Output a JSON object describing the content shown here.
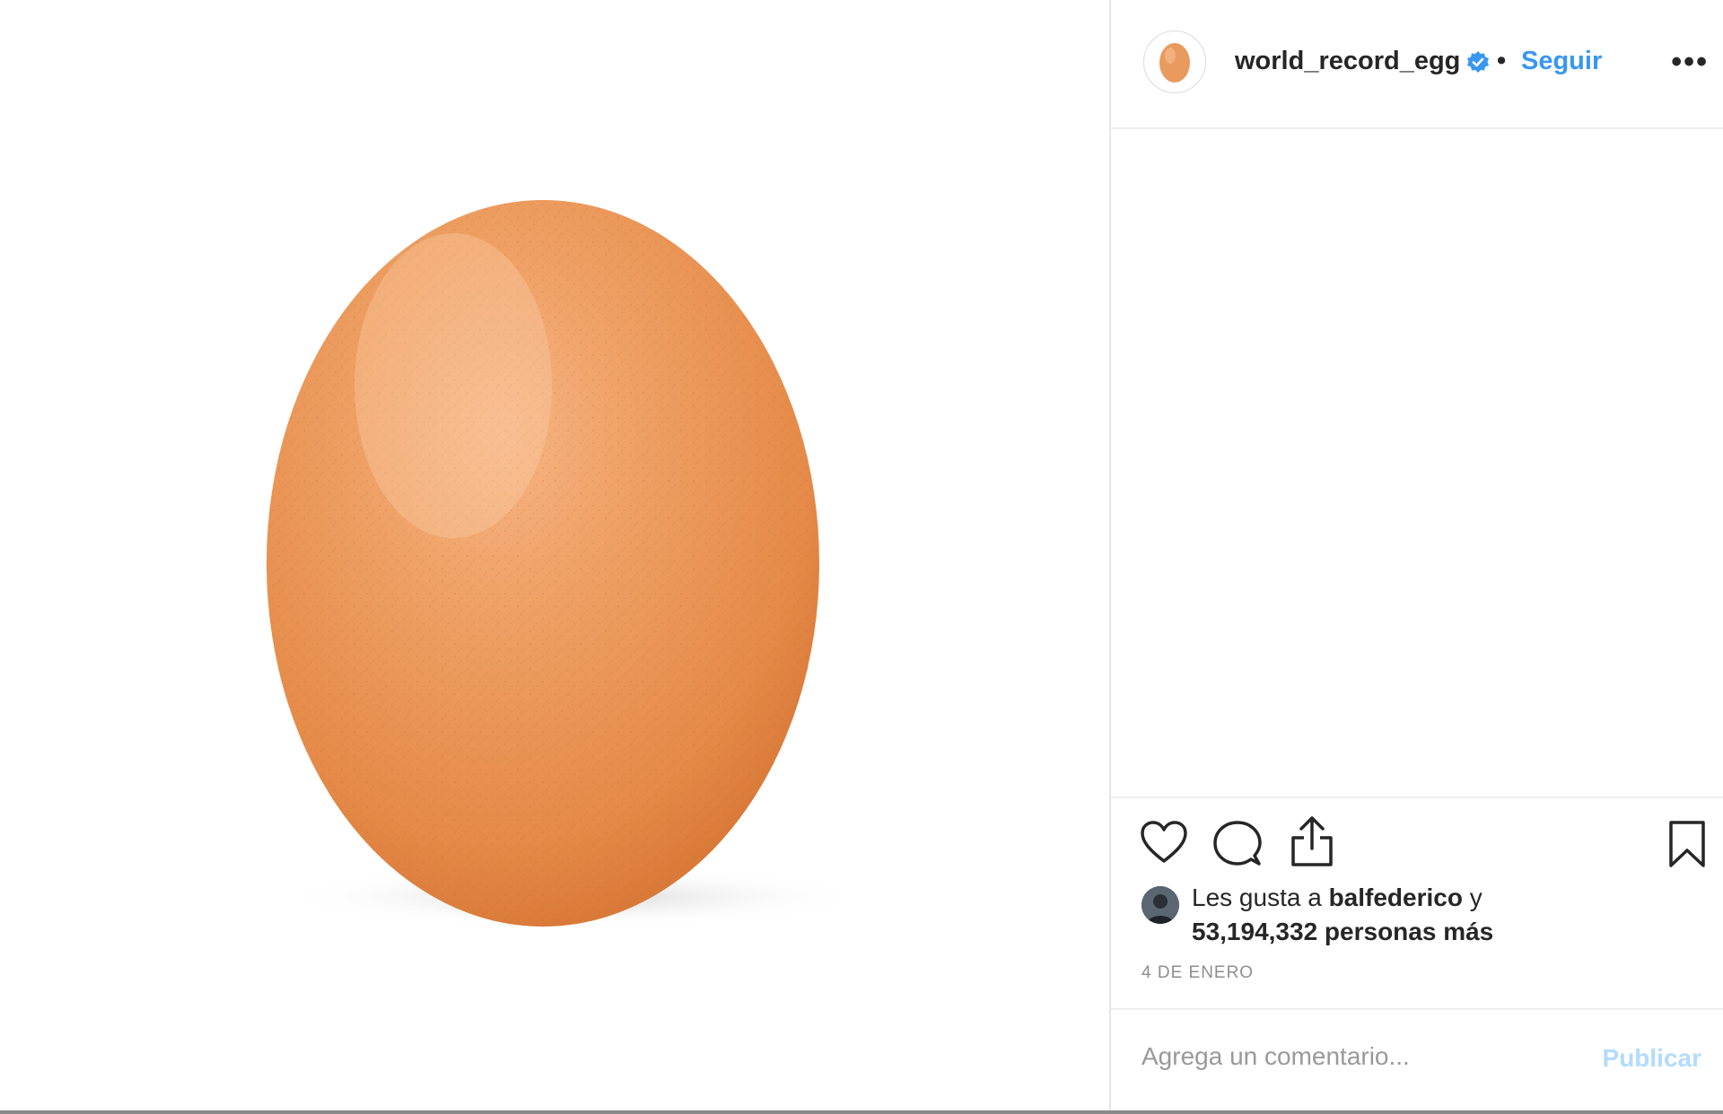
{
  "post": {
    "author": {
      "username": "world_record_egg",
      "verified": true,
      "follow_label": "Seguir",
      "separator": "•"
    },
    "more_label": "•••",
    "actions": {
      "like_icon": "heart-icon",
      "comment_icon": "comment-icon",
      "share_icon": "share-icon",
      "save_icon": "bookmark-icon"
    },
    "likes": {
      "prefix": "Les gusta a",
      "liker": "balfederico",
      "conjunction": "y",
      "count": "53,194,332",
      "suffix": "personas más"
    },
    "date": "4 DE ENERO",
    "comment": {
      "placeholder": "Agrega un comentario...",
      "publish_label": "Publicar"
    }
  },
  "colors": {
    "link": "#3897f0",
    "publish_disabled": "#b3dbff",
    "egg": "#e99a5e",
    "border": "#efefef"
  }
}
